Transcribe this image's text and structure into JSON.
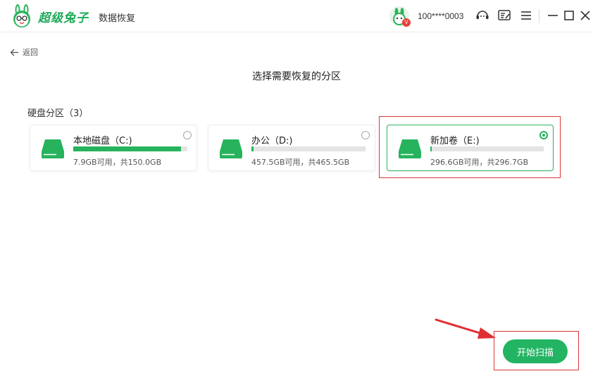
{
  "app": {
    "brand_name": "超级兔子",
    "product_name": "数据恢复",
    "user_id": "100****0003",
    "vip_badge": "V"
  },
  "nav": {
    "back_label": "返回"
  },
  "page": {
    "title": "选择需要恢复的分区",
    "section_title": "硬盘分区（3）"
  },
  "partitions": [
    {
      "name": "本地磁盘（C:)",
      "size_text": "7.9GB可用，共150.0GB",
      "used_fraction": 0.947,
      "selected": false
    },
    {
      "name": "办公（D:)",
      "size_text": "457.5GB可用，共465.5GB",
      "used_fraction": 0.017,
      "selected": false
    },
    {
      "name": "新加卷（E:)",
      "size_text": "296.6GB可用，共296.7GB",
      "used_fraction": 0.003,
      "selected": true
    }
  ],
  "actions": {
    "start_scan_label": "开始扫描"
  },
  "colors": {
    "accent": "#22b463",
    "highlight_box": "#d9363a",
    "bar_track": "#e4e4e4"
  },
  "icons": [
    "rabbit-logo-icon",
    "chat-support-icon",
    "feedback-icon",
    "menu-icon",
    "minimize-icon",
    "maximize-icon",
    "close-icon",
    "back-arrow-icon",
    "hard-drive-icon"
  ]
}
